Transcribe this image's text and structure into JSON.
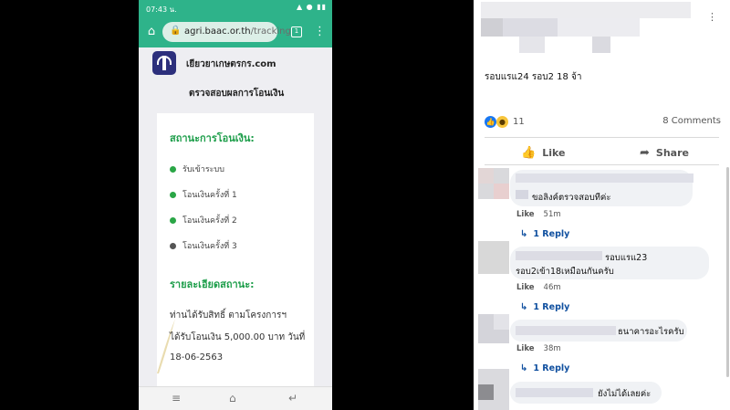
{
  "phone": {
    "status": {
      "time": "07:43 น.",
      "icons": "▲ ● ▮▮"
    },
    "browser": {
      "url_main": "agri.baac.or.th",
      "url_path": "/tracking",
      "tab_count": "1"
    },
    "site_name": "เยียวยาเกษตรกร.com",
    "page_title": "ตรวจสอบผลการโอนเงิน",
    "status_heading": "สถานะการโอนเงิน:",
    "steps": [
      {
        "label": "รับเข้าระบบ",
        "color": "#2aa646"
      },
      {
        "label": "โอนเงินครั้งที่ 1",
        "color": "#2aa646"
      },
      {
        "label": "โอนเงินครั้งที่ 2",
        "color": "#2aa646"
      },
      {
        "label": "โอนเงินครั้งที่ 3",
        "color": "#555555"
      }
    ],
    "details_heading": "รายละเอียดสถานะ:",
    "details_lines": [
      "ท่านได้รับสิทธิ์ ตามโครงการฯ",
      "ได้รับโอนเงิน 5,000.00 บาท วันที่",
      "18-06-2563"
    ],
    "nav": {
      "menu": "≡",
      "home": "⌂",
      "back": "↵"
    },
    "accent_color": "#2eb38a"
  },
  "facebook": {
    "post_text": "รอบแรแ24 รอบ2 18 จ้า",
    "reaction_count": "11",
    "comments_count": "8 Comments",
    "like_label": "Like",
    "share_label": "Share",
    "comments": [
      {
        "text": "ขอลิงค์ตรวจสอบทีค่ะ",
        "text2": "",
        "like": "Like",
        "time": "51m",
        "reply": "1 Reply"
      },
      {
        "text": "รอบแรแ23",
        "text2": "รอบ2เข้า18เหมือนกันครับ",
        "like": "Like",
        "time": "46m",
        "reply": "1 Reply"
      },
      {
        "text": "ธนาคารอะไรครับ",
        "text2": "",
        "like": "Like",
        "time": "38m",
        "reply": "1 Reply"
      },
      {
        "text": "ยังไม่ได้เลยค่ะ",
        "text2": "",
        "like": "",
        "time": "",
        "reply": ""
      }
    ],
    "like_color": "#1877f2"
  }
}
